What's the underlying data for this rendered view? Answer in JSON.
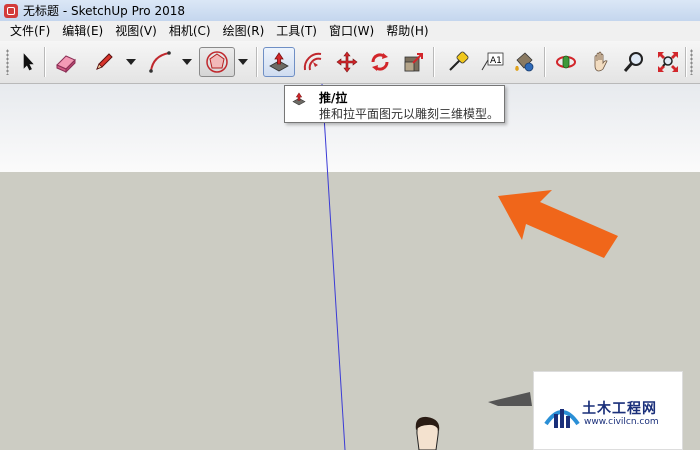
{
  "window": {
    "title": "无标题 - SketchUp Pro 2018"
  },
  "menu": [
    "文件(F)",
    "编辑(E)",
    "视图(V)",
    "相机(C)",
    "绘图(R)",
    "工具(T)",
    "窗口(W)",
    "帮助(H)"
  ],
  "toolbar": {
    "tools": [
      "select-icon",
      "eraser-icon",
      "pencil-icon",
      "arc-icon",
      "polygon-icon",
      "push-pull-icon",
      "offset-icon",
      "move-icon",
      "rotate-icon",
      "scale-icon",
      "tape-measure-icon",
      "text-icon",
      "paint-bucket-icon",
      "orbit-icon",
      "pan-icon",
      "zoom-icon",
      "zoom-extents-icon"
    ]
  },
  "tooltip": {
    "title": "推/拉",
    "description": "推和拉平面图元以雕刻三维模型。"
  },
  "watermark": {
    "title": "土木工程网",
    "url": "www.civilcn.com"
  },
  "colors": {
    "accent_arrow": "#f0661a",
    "ground": "#ccccc3",
    "axis_blue": "#3b3bd6"
  }
}
